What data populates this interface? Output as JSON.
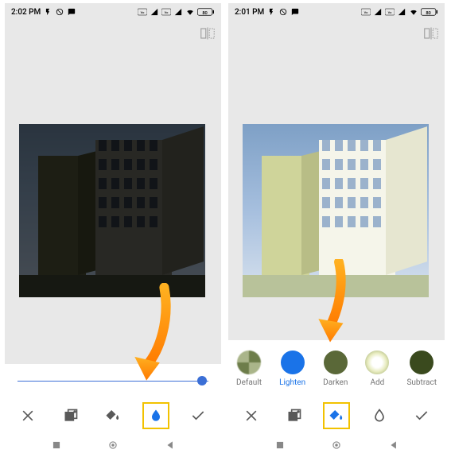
{
  "left": {
    "status": {
      "time": "2:02 PM",
      "battery": "80"
    },
    "toolbar": {
      "cancel": "Cancel",
      "layers": "Layers",
      "fill": "Fill",
      "blend": "Blend mode",
      "confirm": "Confirm"
    },
    "slider": {
      "value": 95
    }
  },
  "right": {
    "status": {
      "time": "2:01 PM",
      "battery": "80"
    },
    "modes": [
      {
        "key": "default",
        "label": "Default",
        "selected": false
      },
      {
        "key": "lighten",
        "label": "Lighten",
        "selected": true
      },
      {
        "key": "darken",
        "label": "Darken",
        "selected": false
      },
      {
        "key": "add",
        "label": "Add",
        "selected": false
      },
      {
        "key": "subtract",
        "label": "Subtract",
        "selected": false
      }
    ],
    "toolbar": {
      "cancel": "Cancel",
      "layers": "Layers",
      "fill": "Fill",
      "blend": "Blend mode",
      "confirm": "Confirm"
    }
  },
  "icons": {
    "compare": "compare-icon",
    "arrow": "annotation-arrow"
  }
}
